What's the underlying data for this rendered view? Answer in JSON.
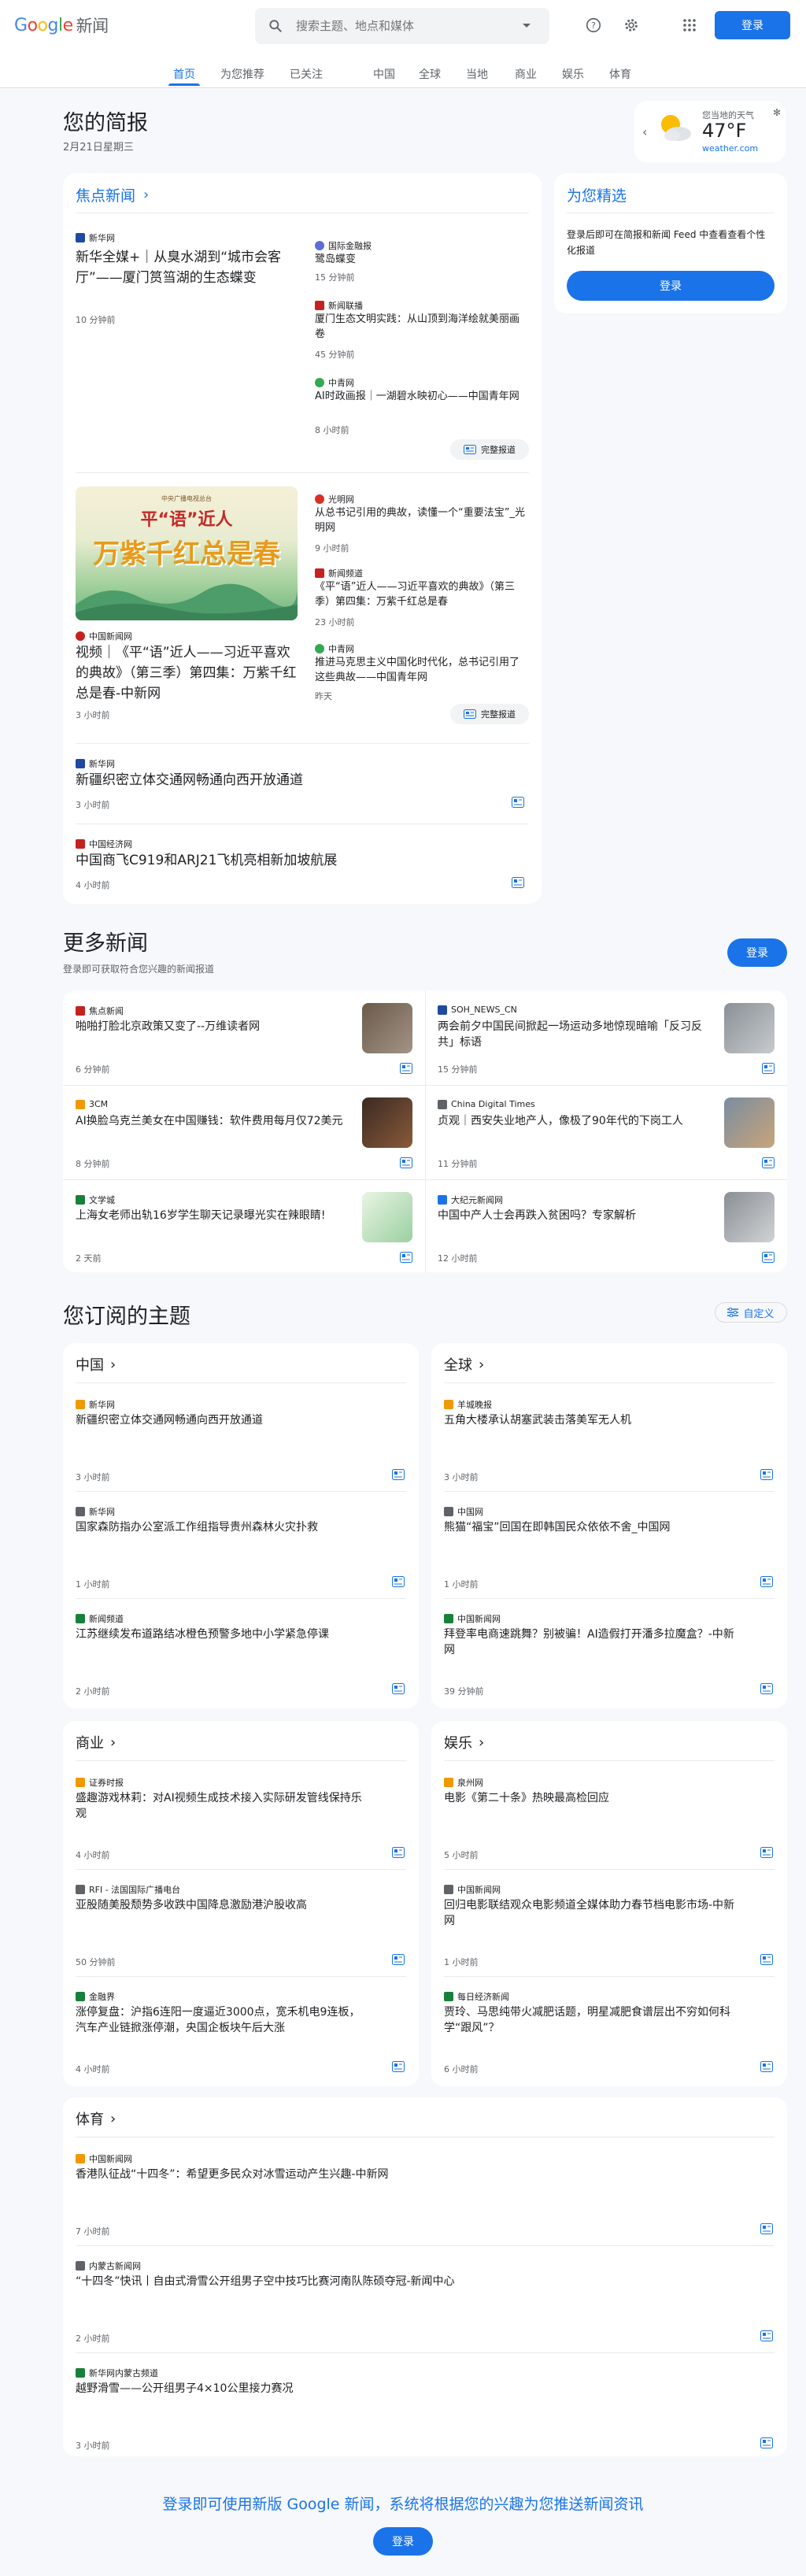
{
  "header": {
    "logo_letters": [
      "G",
      "o",
      "o",
      "g",
      "l",
      "e"
    ],
    "logo_suffix": "新闻",
    "search_placeholder": "搜索主题、地点和媒体",
    "login": "登录"
  },
  "nav": [
    "首页",
    "为您推荐",
    "已关注",
    "中国",
    "全球",
    "当地",
    "商业",
    "娱乐",
    "体育"
  ],
  "brief": {
    "title": "您的简报",
    "date": "2月21日星期三"
  },
  "weather": {
    "label": "您当地的天气",
    "temp": "47°F",
    "source": "weather.com"
  },
  "top": {
    "title": "焦点新闻",
    "lead1": {
      "source": "新华网",
      "title": "新华全媒+｜从臭水湖到“城市会客厅”——厦门筼筜湖的生态蝶变",
      "time": "10 分钟前"
    },
    "side1": [
      {
        "source": "国际金融报",
        "title": "鹭岛蝶变",
        "time": "15 分钟前"
      },
      {
        "source": "新闻联播",
        "title": "厦门生态文明实践：从山顶到海洋绘就美丽画卷",
        "time": "45 分钟前"
      },
      {
        "source": "中青网",
        "title": "AI时政画报｜一湖碧水映初心——中国青年网",
        "time": "8 小时前"
      }
    ],
    "full": "完整报道",
    "lead2": {
      "source": "中国新闻网",
      "title": "视频｜《平“语”近人——习近平喜欢的典故》（第三季）第四集：万紫千红总是春-中新网",
      "time": "3 小时前",
      "img_small": "中央广播电视总台",
      "img_line1": "平“语”近人",
      "img_big": "万紫千红总是春"
    },
    "side2": [
      {
        "source": "光明网",
        "title": "从总书记引用的典故，读懂一个“重要法宝”_光明网",
        "time": "9 小时前"
      },
      {
        "source": "新闻频道",
        "title": "《平“语”近人——习近平喜欢的典故》（第三季）第四集：万紫千红总是春",
        "time": "23 小时前"
      },
      {
        "source": "中青网",
        "title": "推进马克思主义中国化时代化，总书记引用了这些典故——中国青年网",
        "time": "昨天"
      }
    ],
    "single": [
      {
        "source": "新华网",
        "title": "新疆织密立体交通网畅通向西开放通道",
        "time": "3 小时前"
      },
      {
        "source": "中国经济网",
        "title": "中国商飞C919和ARJ21飞机亮相新加坡航展",
        "time": "4 小时前"
      }
    ]
  },
  "picks": {
    "title": "为您精选",
    "desc": "登录后即可在简报和新闻 Feed 中查看查看个性化报道",
    "login": "登录"
  },
  "more": {
    "title": "更多新闻",
    "sub": "登录即可获取符合您兴趣的新闻报道",
    "login": "登录",
    "items": [
      {
        "source": "焦点新闻",
        "title": "啪啪打脸北京政策又变了--万维读者网",
        "time": "6 分钟前"
      },
      {
        "source": "SOH_NEWS_CN",
        "title": "两会前夕中国民间掀起一场运动多地惊现暗喻「反习反共」标语",
        "time": "15 分钟前"
      },
      {
        "source": "3CM",
        "title": "AI换脸乌克兰美女在中国赚钱：软件费用每月仅72美元",
        "time": "8 分钟前"
      },
      {
        "source": "China Digital Times",
        "title": "贞观｜西安失业地产人，像极了90年代的下岗工人",
        "time": "11 分钟前"
      },
      {
        "source": "文学城",
        "title": "上海女老师出轨16岁学生聊天记录曝光实在辣眼睛!",
        "time": "2 天前"
      },
      {
        "source": "大纪元新闻网",
        "title": "中国中产人士会再跌入贫困吗？专家解析",
        "time": "12 小时前"
      }
    ]
  },
  "topics": {
    "title": "您订阅的主题",
    "customize": "自定义",
    "groups": [
      {
        "name": "中国",
        "items": [
          {
            "source": "新华网",
            "title": "新疆织密立体交通网畅通向西开放通道",
            "time": "3 小时前"
          },
          {
            "source": "新华网",
            "title": "国家森防指办公室派工作组指导贵州森林火灾扑救",
            "time": "1 小时前"
          },
          {
            "source": "新闻频道",
            "title": "江苏继续发布道路结冰橙色预警多地中小学紧急停课",
            "time": "2 小时前"
          }
        ]
      },
      {
        "name": "全球",
        "items": [
          {
            "source": "羊城晚报",
            "title": "五角大楼承认胡塞武装击落美军无人机",
            "time": "3 小时前"
          },
          {
            "source": "中国网",
            "title": "熊猫“福宝”回国在即韩国民众依依不舍_中国网",
            "time": "1 小时前"
          },
          {
            "source": "中国新闻网",
            "title": "拜登率电商速跳舞？别被骗！AI造假打开潘多拉魔盒？-中新网",
            "time": "39 分钟前"
          }
        ]
      },
      {
        "name": "商业",
        "items": [
          {
            "source": "证券时报",
            "title": "盛趣游戏林莉：对AI视频生成技术接入实际研发管线保持乐观",
            "time": "4 小时前"
          },
          {
            "source": "RFI - 法国国际广播电台",
            "title": "亚股随美股颓势多收跌中国降息激励港沪股收高",
            "time": "50 分钟前"
          },
          {
            "source": "金融界",
            "title": "涨停复盘：沪指6连阳一度逼近3000点，宽禾机电9连板，汽车产业链掀涨停潮，央国企板块午后大涨",
            "time": "4 小时前"
          }
        ]
      },
      {
        "name": "娱乐",
        "items": [
          {
            "source": "泉州网",
            "title": "电影《第二十条》热映最高检回应",
            "time": "5 小时前"
          },
          {
            "source": "中国新闻网",
            "title": "回归电影联结观众电影频道全媒体助力春节档电影市场-中新网",
            "time": "1 小时前"
          },
          {
            "source": "每日经济新闻",
            "title": "贾玲、马思纯带火减肥话题，明星减肥食谱层出不穷如何科学“跟风”？",
            "time": "6 小时前"
          }
        ]
      }
    ],
    "sports": {
      "name": "体育",
      "items": [
        {
          "source": "中国新闻网",
          "title": "香港队征战“十四冬”：希望更多民众对冰雪运动产生兴趣-中新网",
          "time": "7 小时前"
        },
        {
          "source": "内蒙古新闻网",
          "title": "“十四冬”快讯丨自由式滑雪公开组男子空中技巧比赛河南队陈硕夺冠-新闻中心",
          "time": "2 小时前"
        },
        {
          "source": "新华网内蒙古频道",
          "title": "越野滑雪——公开组男子4×10公里接力赛况",
          "time": "3 小时前"
        }
      ]
    }
  },
  "footer": {
    "text": "登录即可使用新版 Google 新闻，系统将根据您的兴趣为您推送新闻资讯",
    "login": "登录"
  },
  "colors": {
    "accent": "#1a73e8",
    "bg": "#f6f8fc"
  }
}
